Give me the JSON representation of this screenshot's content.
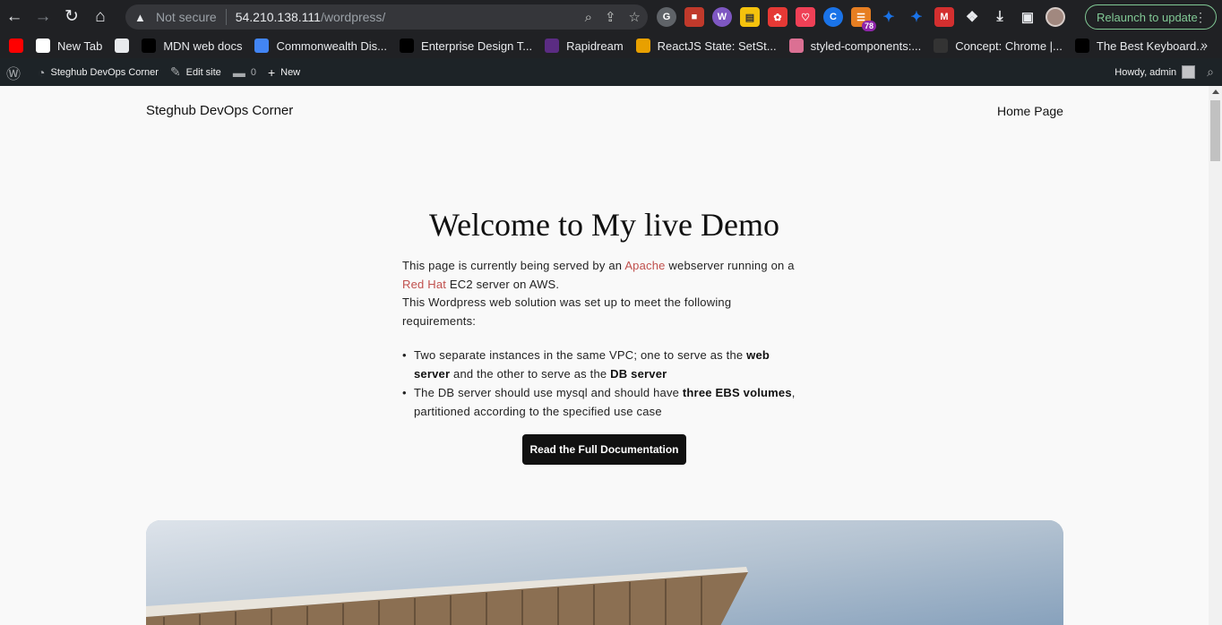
{
  "browser": {
    "omnibox": {
      "security_label": "Not secure",
      "host": "54.210.138.111",
      "path": "/wordpress/"
    },
    "extension_badge": "78",
    "relaunch_label": "Relaunch to update",
    "bookmarks": [
      {
        "label": "",
        "icon": "youtube-icon",
        "color": "#ff0000"
      },
      {
        "label": "New Tab",
        "icon": "google-icon",
        "color": "#ffffff"
      },
      {
        "label": "",
        "icon": "globe-icon",
        "color": "#e8eaed"
      },
      {
        "label": "MDN web docs",
        "icon": "mdn-icon",
        "color": "#000000"
      },
      {
        "label": "Commonwealth Dis...",
        "icon": "globe-icon",
        "color": "#4285f4"
      },
      {
        "label": "Enterprise Design T...",
        "icon": "ibm-icon",
        "color": "#000000"
      },
      {
        "label": "Rapidream",
        "icon": "rapidream-icon",
        "color": "#5b2c83"
      },
      {
        "label": "ReactJS State: SetSt...",
        "icon": "article-icon",
        "color": "#e8a000"
      },
      {
        "label": "styled-components:...",
        "icon": "styled-icon",
        "color": "#db7093"
      },
      {
        "label": "Concept: Chrome |...",
        "icon": "concept-icon",
        "color": "#333333"
      },
      {
        "label": "The Best Keyboard...",
        "icon": "htg-icon",
        "color": "#000000"
      }
    ]
  },
  "adminbar": {
    "site_name": "Steghub DevOps Corner",
    "edit_site": "Edit site",
    "comments_count": "0",
    "new_label": "New",
    "howdy": "Howdy, admin"
  },
  "site": {
    "title": "Steghub DevOps Corner",
    "nav_home": "Home Page"
  },
  "hero": {
    "title": "Welcome to My live Demo",
    "intro_1": "This page is currently being served by an ",
    "intro_link_apache": "Apache",
    "intro_2": " webserver running on a ",
    "intro_link_redhat": "Red Hat",
    "intro_3": " EC2 server on AWS.",
    "intro_4": "This Wordpress web solution was set up to meet the following requirements:",
    "req1_a": "Two separate instances in the same VPC; one to serve as the ",
    "req1_b": "web server",
    "req1_c": " and the other to serve as the ",
    "req1_d": "DB server",
    "req2_a": "The DB server should use mysql and should have ",
    "req2_b": "three EBS volumes",
    "req2_c": ", partitioned according to the specified use case",
    "button_label": "Read the Full Documentation"
  },
  "colors": {
    "link": "#c0504d",
    "adminbar_bg": "#1d2327",
    "chrome_bg": "#202124"
  }
}
